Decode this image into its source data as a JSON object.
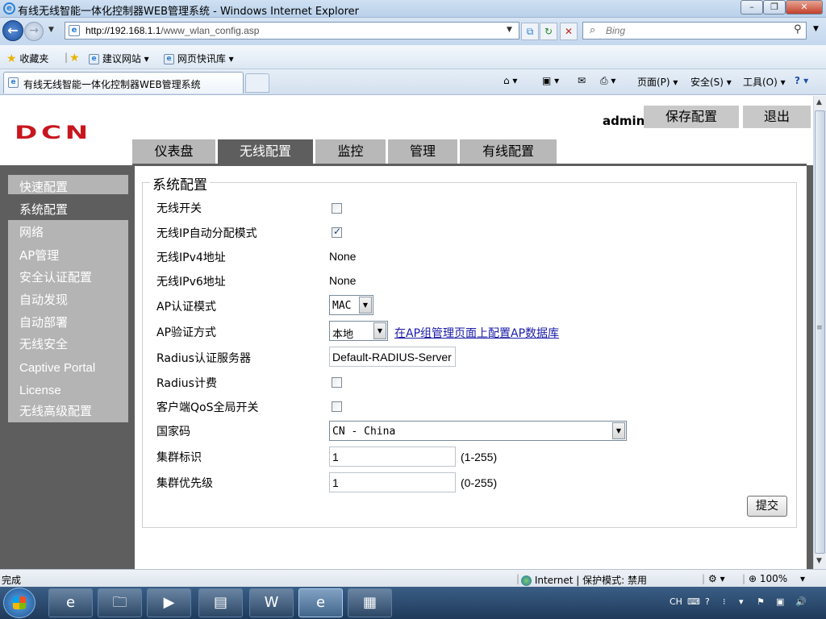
{
  "window": {
    "title": "有线无线智能一体化控制器WEB管理系统 - Windows Internet Explorer",
    "min": "–",
    "max": "❐",
    "close": "✕"
  },
  "nav": {
    "url_host": "http://192.168.1.1",
    "url_path": "/www_wlan_config.asp",
    "search_placeholder": "Bing"
  },
  "favbar": {
    "favorites": "收藏夹",
    "suggested": "建议网站 ▾",
    "slices": "网页快讯库 ▾"
  },
  "tabbar": {
    "active_tab": "有线无线智能一体化控制器WEB管理系统",
    "page_menu": "页面(P) ▾",
    "safety_menu": "安全(S) ▾",
    "tools_menu": "工具(O) ▾"
  },
  "header": {
    "logo": "DCN",
    "user": "admin",
    "save": "保存配置",
    "logout": "退出"
  },
  "tabs": [
    "仪表盘",
    "无线配置",
    "监控",
    "管理",
    "有线配置"
  ],
  "sidebar": [
    "快速配置",
    "系统配置",
    "网络",
    "AP管理",
    "安全认证配置",
    "自动发现",
    "自动部署",
    "无线安全",
    "Captive Portal",
    "License",
    "无线高级配置"
  ],
  "form": {
    "legend": "系统配置",
    "labels": {
      "wireless_switch": "无线开关",
      "ip_auto": "无线IP自动分配模式",
      "ipv4": "无线IPv4地址",
      "ipv6": "无线IPv6地址",
      "ap_auth_mode": "AP认证模式",
      "ap_verify": "AP验证方式",
      "radius_server": "Radius认证服务器",
      "radius_acct": "Radius计费",
      "qos": "客户端QoS全局开关",
      "country": "国家码",
      "cluster_id": "集群标识",
      "cluster_priority": "集群优先级"
    },
    "values": {
      "wireless_switch": false,
      "ip_auto": true,
      "ipv4": "None",
      "ipv6": "None",
      "ap_auth_mode": "MAC",
      "ap_verify": "本地",
      "ap_db_link": "在AP组管理页面上配置AP数据库",
      "radius_server": "Default-RADIUS-Server",
      "radius_acct": false,
      "qos": false,
      "country": "CN - China",
      "cluster_id": "1",
      "cluster_id_range": "(1-255)",
      "cluster_priority": "1",
      "cluster_priority_range": "(0-255)"
    },
    "submit": "提交"
  },
  "status": {
    "left": "完成",
    "zone": "Internet | 保护模式: 禁用",
    "zoom": "100%"
  },
  "taskbar": {
    "lang": "CH"
  }
}
